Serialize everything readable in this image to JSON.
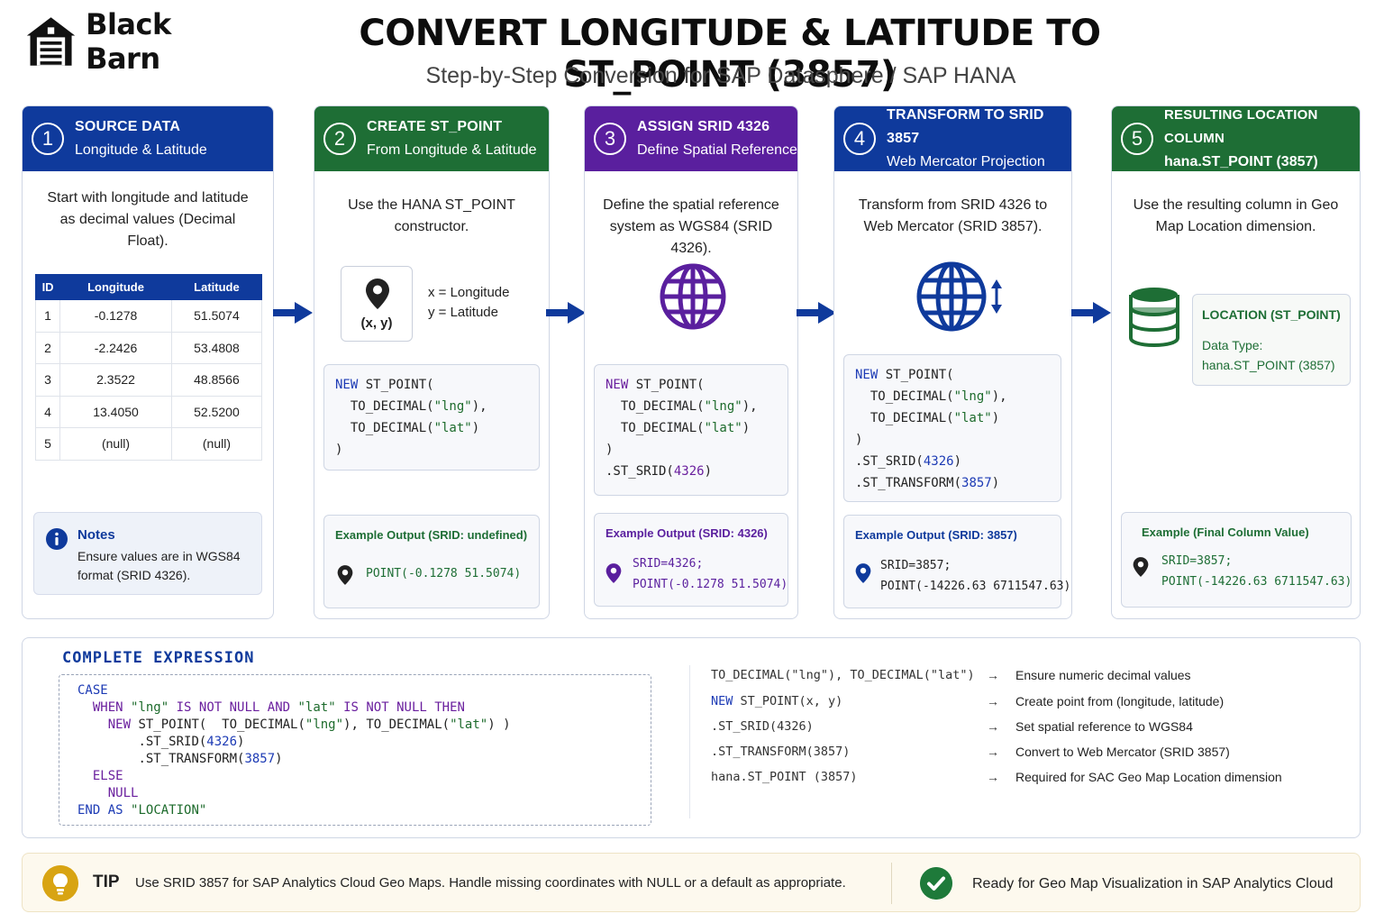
{
  "brand": {
    "name": "Black Barn"
  },
  "title": "CONVERT LONGITUDE & LATITUDE TO ST_POINT (3857)",
  "subtitle": "Step-by-Step Conversion for SAP Datasphere / SAP HANA",
  "colors": {
    "blue": "#0f3a9c",
    "green": "#1e6e35",
    "purple": "#5a1f9e",
    "tip": "#d8a413",
    "ok": "#1e7a3a"
  },
  "steps": [
    {
      "number": "1",
      "title": "SOURCE DATA",
      "subtitle": "Longitude & Latitude",
      "description": "Start with longitude and latitude as decimal values (Decimal Float).",
      "table": {
        "columns": [
          "ID",
          "Longitude",
          "Latitude"
        ],
        "rows": [
          [
            "1",
            "-0.1278",
            "51.5074"
          ],
          [
            "2",
            "-2.2426",
            "53.4808"
          ],
          [
            "3",
            "2.3522",
            "48.8566"
          ],
          [
            "4",
            "13.4050",
            "52.5200"
          ],
          [
            "5",
            "(null)",
            "(null)"
          ]
        ]
      },
      "notes_title": "Notes",
      "notes_text": "Ensure values are in WGS84 format (SRID 4326).",
      "icon": "info-icon"
    },
    {
      "number": "2",
      "title": "CREATE ST_POINT",
      "subtitle": "From Longitude & Latitude",
      "description": "Use the HANA ST_POINT constructor.",
      "pin_label": "(x, y)",
      "x_label": "x = Longitude",
      "y_label": "y = Latitude",
      "code": {
        "l1a": "NEW",
        "l1b": " ST_POINT(",
        "l2a": "  TO_DECIMAL(",
        "l2b": "\"lng\"",
        "l2c": "),",
        "l3a": "  TO_DECIMAL(",
        "l3b": "\"lat\"",
        "l3c": ")",
        "l4": ")"
      },
      "output_title": "Example Output (SRID: undefined)",
      "output_line1": "POINT(-0.1278 51.5074)",
      "icon": "map-pin-icon"
    },
    {
      "number": "3",
      "title": "ASSIGN SRID 4326",
      "subtitle": "Define Spatial Reference",
      "description": "Define the spatial reference system as WGS84 (SRID 4326).",
      "code": {
        "l5a": ".ST_SRID(",
        "l5b": "4326",
        "l5c": ")"
      },
      "output_title": "Example Output (SRID: 4326)",
      "output_line1": "SRID=4326;",
      "output_line2": "POINT(-0.1278 51.5074)",
      "icon": "globe-icon"
    },
    {
      "number": "4",
      "title": "TRANSFORM TO SRID 3857",
      "subtitle": "Web Mercator Projection",
      "description": "Transform from SRID 4326 to Web Mercator (SRID 3857).",
      "code": {
        "l6a": ".ST_TRANSFORM(",
        "l6b": "3857",
        "l6c": ")"
      },
      "output_title": "Example Output (SRID: 3857)",
      "output_line1": "SRID=3857;",
      "output_line2": "POINT(-14226.63 6711547.63)",
      "icon": "globe-transform-icon"
    },
    {
      "number": "5",
      "title": "RESULTING LOCATION COLUMN",
      "subtitle": "hana.ST_POINT (3857)",
      "description": "Use the resulting column in Geo Map Location dimension.",
      "column_title": "LOCATION (ST_POINT)",
      "column_type_label": "Data Type:",
      "column_type": "hana.ST_POINT (3857)",
      "output_title": "Example (Final Column Value)",
      "output_line1": "SRID=3857;",
      "output_line2": "POINT(-14226.63 6711547.63)",
      "icon": "database-icon"
    }
  ],
  "complete_expression": {
    "title": "COMPLETE EXPRESSION",
    "case": "CASE",
    "when": "WHEN",
    "lng": "\"lng\"",
    "is_not_null": "IS NOT NULL",
    "and": "AND",
    "lat": "\"lat\"",
    "then": "THEN",
    "new": "NEW",
    "st_point_open": " ST_POINT(  TO_DECIMAL(",
    "comma_to_decimal": "), TO_DECIMAL(",
    "close": ") )",
    "st_srid": ".ST_SRID(",
    "srid": "4326",
    "st_transform": ".ST_TRANSFORM(",
    "target_srid": "3857",
    "paren_close": ")",
    "else": "ELSE",
    "null": "NULL",
    "end": "END",
    "as": "AS",
    "alias": "\"LOCATION\""
  },
  "legend": [
    {
      "code": "TO_DECIMAL(\"lng\"), TO_DECIMAL(\"lat\")",
      "arrow": "→",
      "text": "Ensure numeric decimal values"
    },
    {
      "code": "NEW ST_POINT(x, y)",
      "arrow": "→",
      "text": "Create point from (longitude, latitude)"
    },
    {
      "code": ".ST_SRID(4326)",
      "arrow": "→",
      "text": "Set spatial reference to WGS84"
    },
    {
      "code": ".ST_TRANSFORM(3857)",
      "arrow": "→",
      "text": "Convert to Web Mercator (SRID 3857)"
    },
    {
      "code": "hana.ST_POINT (3857)",
      "arrow": "→",
      "text": "Required for SAC Geo Map Location dimension"
    }
  ],
  "tip": {
    "label": "TIP",
    "text": "Use SRID 3857 for SAP Analytics Cloud Geo Maps. Handle missing coordinates with NULL or a default as appropriate.",
    "ready": "Ready for Geo Map Visualization in SAP Analytics Cloud"
  }
}
